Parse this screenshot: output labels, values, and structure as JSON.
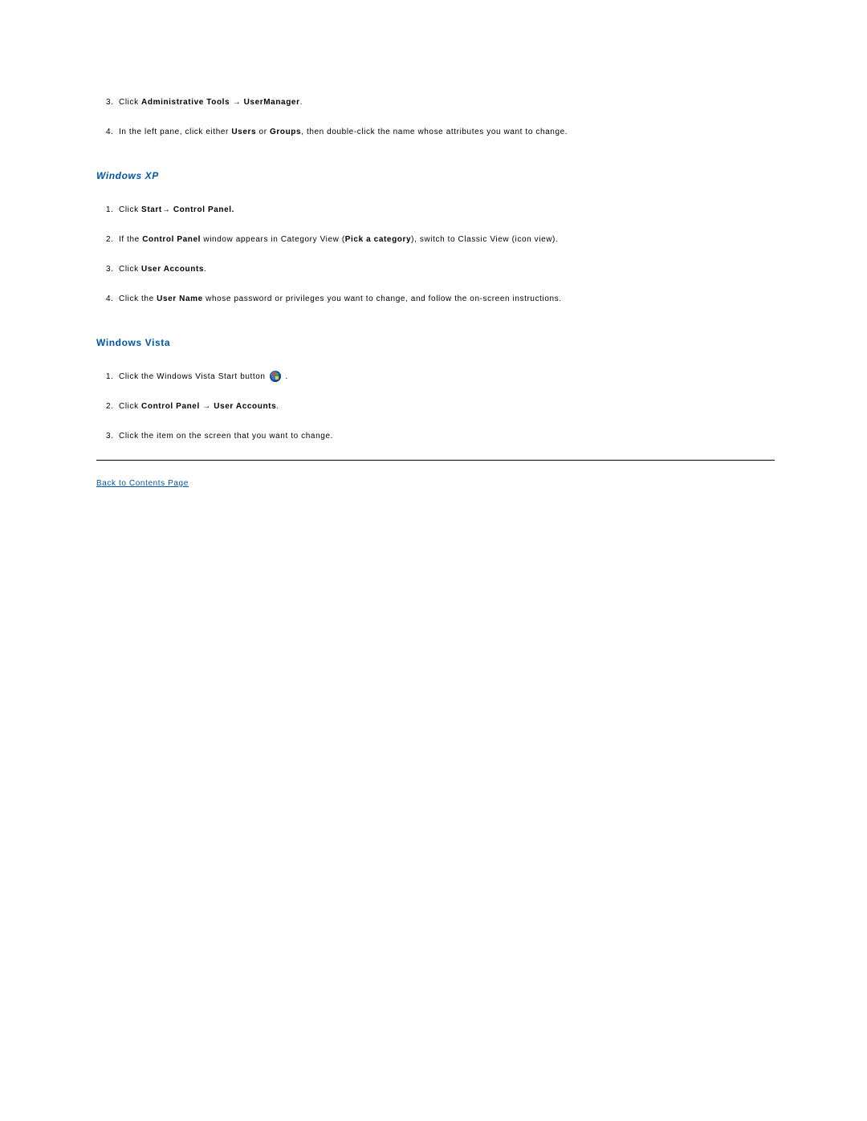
{
  "section1": {
    "steps": [
      {
        "num": "3.",
        "parts": [
          {
            "text": "Click ",
            "bold": false
          },
          {
            "text": "Administrative Tools",
            "bold": true
          },
          {
            "text": " ",
            "bold": false
          },
          {
            "text": "→",
            "arrow": true
          },
          {
            "text": " ",
            "bold": false
          },
          {
            "text": "UserManager",
            "bold": true
          },
          {
            "text": ".",
            "bold": false
          }
        ]
      },
      {
        "num": "4.",
        "parts": [
          {
            "text": "In the left pane, click either ",
            "bold": false
          },
          {
            "text": "Users",
            "bold": true
          },
          {
            "text": " or ",
            "bold": false
          },
          {
            "text": "Groups",
            "bold": true
          },
          {
            "text": ", then double-click the name whose attributes you want to change.",
            "bold": false
          }
        ]
      }
    ]
  },
  "section2": {
    "heading": "Windows XP",
    "steps": [
      {
        "num": "1.",
        "parts": [
          {
            "text": "Click ",
            "bold": false
          },
          {
            "text": "Start",
            "bold": true
          },
          {
            "text": "→ ",
            "arrow": true
          },
          {
            "text": "Control Panel.",
            "bold": true
          }
        ]
      },
      {
        "num": "2.",
        "parts": [
          {
            "text": "If the ",
            "bold": false
          },
          {
            "text": "Control Panel",
            "bold": true
          },
          {
            "text": " window appears in Category View (",
            "bold": false
          },
          {
            "text": "Pick a category",
            "bold": true
          },
          {
            "text": "), switch to Classic View (icon view).",
            "bold": false
          }
        ]
      },
      {
        "num": "3.",
        "parts": [
          {
            "text": "Click ",
            "bold": false
          },
          {
            "text": "User Accounts",
            "bold": true
          },
          {
            "text": ".",
            "bold": false
          }
        ]
      },
      {
        "num": "4.",
        "parts": [
          {
            "text": "Click the ",
            "bold": false
          },
          {
            "text": "User Name",
            "bold": true
          },
          {
            "text": " whose password or privileges you want to change, and follow the on-screen instructions.",
            "bold": false
          }
        ]
      }
    ]
  },
  "section3": {
    "heading": "Windows Vista",
    "steps": [
      {
        "num": "1.",
        "parts": [
          {
            "text": "Click the Windows Vista Start button ",
            "bold": false
          },
          {
            "icon": "vista-start"
          },
          {
            "text": " .",
            "bold": false
          }
        ]
      },
      {
        "num": "2.",
        "parts": [
          {
            "text": "Click ",
            "bold": false
          },
          {
            "text": "Control Panel",
            "bold": true
          },
          {
            "text": " ",
            "bold": false
          },
          {
            "text": "→",
            "arrow": true
          },
          {
            "text": " ",
            "bold": false
          },
          {
            "text": "User Accounts",
            "bold": true
          },
          {
            "text": ".",
            "bold": false
          }
        ]
      },
      {
        "num": "3.",
        "parts": [
          {
            "text": "Click the item on the screen that you want to change.",
            "bold": false
          }
        ]
      }
    ]
  },
  "back_link": "Back to Contents Page"
}
